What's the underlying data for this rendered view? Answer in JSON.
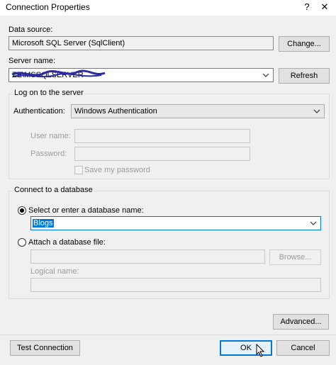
{
  "window": {
    "title": "Connection Properties",
    "help_glyph": "?",
    "close_glyph": "✕"
  },
  "data_source": {
    "label": "Data source:",
    "value": "Microsoft SQL Server (SqlClient)",
    "change_button": "Change..."
  },
  "server": {
    "label": "Server name:",
    "value": "ZE\\MSSQLSERVER",
    "refresh_button": "Refresh"
  },
  "logon": {
    "group_title": "Log on to the server",
    "auth_label": "Authentication:",
    "auth_value": "Windows Authentication",
    "user_label": "User name:",
    "user_value": "",
    "password_label": "Password:",
    "password_value": "",
    "save_password_label": "Save my password"
  },
  "database": {
    "group_title": "Connect to a database",
    "select_option_label": "Select or enter a database name:",
    "selected_db": "Blogs",
    "attach_option_label": "Attach a database file:",
    "attach_value": "",
    "browse_button": "Browse...",
    "logical_name_label": "Logical name:",
    "logical_name_value": ""
  },
  "footer": {
    "advanced_button": "Advanced...",
    "test_button": "Test Connection",
    "ok_button": "OK",
    "cancel_button": "Cancel"
  },
  "colors": {
    "accent": "#0078d7",
    "window_bg": "#f0f0f0",
    "scribble": "#2b2ba0"
  }
}
